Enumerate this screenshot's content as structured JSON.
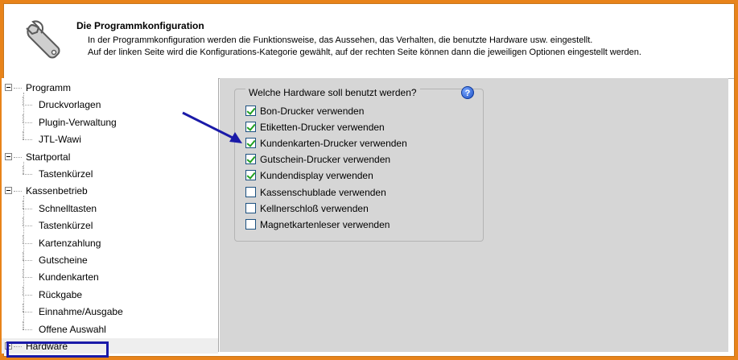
{
  "header": {
    "title": "Die Programmkonfiguration",
    "description_line1": "In der Programmkonfiguration werden die Funktionsweise, das Aussehen, das Verhalten, die benutzte Hardware usw. eingestellt.",
    "description_line2": "Auf der linken Seite wird die Konfigurations-Kategorie gewählt, auf der rechten Seite können dann die jeweiligen Optionen eingestellt werden.",
    "icon": "wrench-icon"
  },
  "tree": {
    "items": [
      {
        "label": "Programm",
        "level": 0
      },
      {
        "label": "Druckvorlagen",
        "level": 1
      },
      {
        "label": "Plugin-Verwaltung",
        "level": 1
      },
      {
        "label": "JTL-Wawi",
        "level": 1
      },
      {
        "label": "Startportal",
        "level": 0
      },
      {
        "label": "Tastenkürzel",
        "level": 1
      },
      {
        "label": "Kassenbetrieb",
        "level": 0
      },
      {
        "label": "Schnelltasten",
        "level": 1
      },
      {
        "label": "Tastenkürzel",
        "level": 1
      },
      {
        "label": "Kartenzahlung",
        "level": 1
      },
      {
        "label": "Gutscheine",
        "level": 1
      },
      {
        "label": "Kundenkarten",
        "level": 1
      },
      {
        "label": "Rückgabe",
        "level": 1
      },
      {
        "label": "Einnahme/Ausgabe",
        "level": 1
      },
      {
        "label": "Offene Auswahl",
        "level": 1
      },
      {
        "label": "Hardware",
        "level": 0,
        "selected": true
      }
    ]
  },
  "hardware": {
    "group_title": "Welche Hardware soll benutzt werden?",
    "help_icon": "help-icon",
    "options": [
      {
        "label": "Bon-Drucker verwenden",
        "checked": true
      },
      {
        "label": "Etiketten-Drucker verwenden",
        "checked": true
      },
      {
        "label": "Kundenkarten-Drucker verwenden",
        "checked": true
      },
      {
        "label": "Gutschein-Drucker verwenden",
        "checked": true
      },
      {
        "label": "Kundendisplay verwenden",
        "checked": true
      },
      {
        "label": "Kassenschublade verwenden",
        "checked": false
      },
      {
        "label": "Kellnerschloß verwenden",
        "checked": false
      },
      {
        "label": "Magnetkartenleser verwenden",
        "checked": false
      }
    ]
  },
  "colors": {
    "frame": "#e8831a",
    "annotation": "#1a1aa8",
    "check": "#21a121",
    "panel": "#d6d6d6"
  }
}
